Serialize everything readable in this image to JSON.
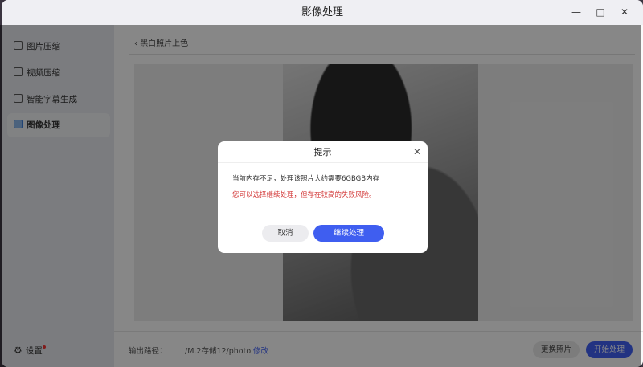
{
  "window": {
    "title": "影像处理",
    "minimize": "—",
    "maximize": "□",
    "close": "✕"
  },
  "sidebar": {
    "items": [
      {
        "label": "图片压缩"
      },
      {
        "label": "视频压缩"
      },
      {
        "label": "智能字幕生成"
      },
      {
        "label": "图像处理",
        "active": true
      }
    ],
    "settings_label": "设置"
  },
  "main": {
    "breadcrumb": "黑白照片上色",
    "back": "‹"
  },
  "footer": {
    "output_label": "输出路径：",
    "output_path": "/M.2存储12/photo",
    "modify": "修改",
    "replace_button": "更换照片",
    "start_button": "开始处理"
  },
  "dialog": {
    "title": "提示",
    "close": "✕",
    "message": "当前内存不足，处理该照片大约需要6GBGB内存",
    "warning": "您可以选择继续处理，但存在较高的失败风险。",
    "cancel": "取消",
    "continue": "继续处理"
  },
  "colors": {
    "accent": "#3f5ef0",
    "warning": "#d33a3a"
  }
}
